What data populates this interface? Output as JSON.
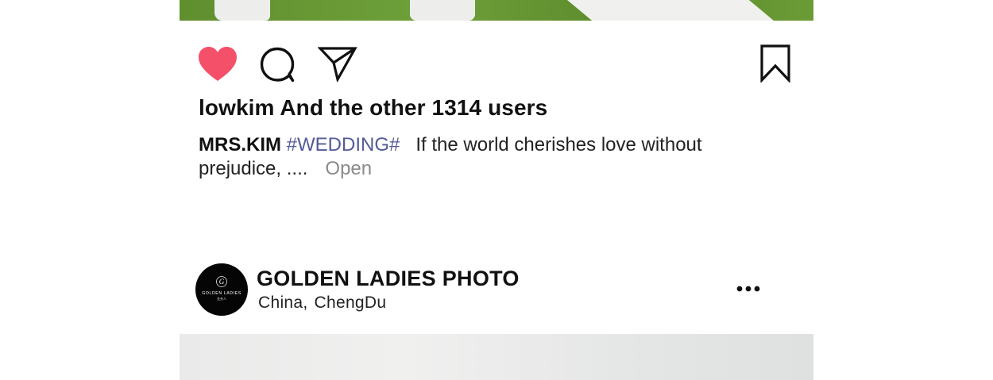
{
  "post": {
    "likes_text": "lowkim And the other 1314 users",
    "caption": {
      "username": "MRS.KIM",
      "hashtag": "#WEDDING#",
      "text": "If the world cherishes love without prejudice, ....",
      "open_label": "Open"
    },
    "icons": {
      "like": "heart-icon",
      "comment": "comment-icon",
      "share": "paper-plane-icon",
      "save": "bookmark-icon"
    },
    "colors": {
      "like": "#f4506a",
      "hashtag": "#545a98",
      "open": "#8a8a8a"
    }
  },
  "next_post": {
    "account_name": "GOLDEN LADIES PHOTO",
    "location_country": "China,",
    "location_city": "ChengDu",
    "avatar_text": "GOLDEN LADIES",
    "avatar_monogram": "G",
    "avatar_subtext": "金夫人",
    "more_icon": "more-horizontal-icon"
  }
}
